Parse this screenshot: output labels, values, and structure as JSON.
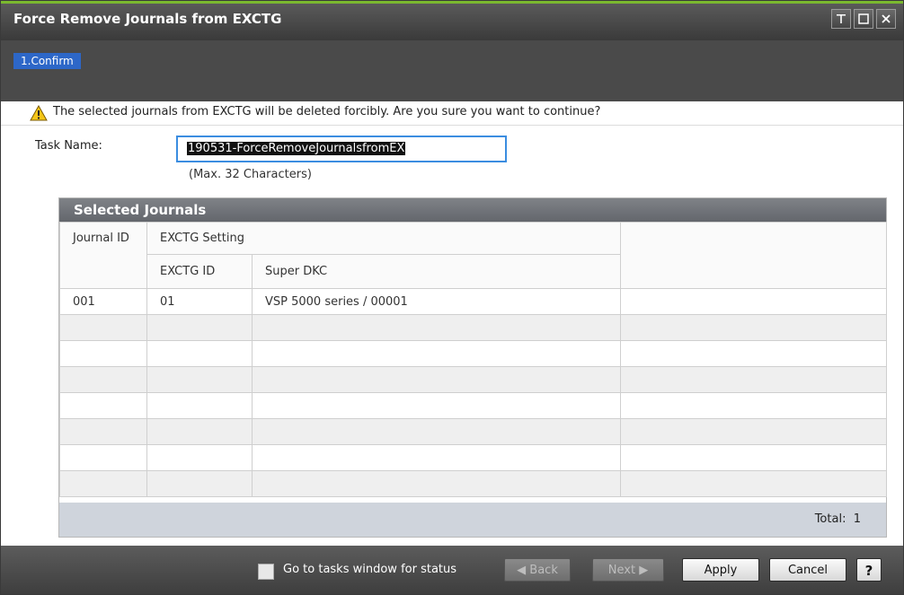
{
  "window": {
    "title": "Force Remove Journals from EXCTG",
    "controls": [
      "pin-icon",
      "maximize-icon",
      "close-icon"
    ]
  },
  "wizard": {
    "step": "1.Confirm"
  },
  "warning": {
    "icon": "warning-icon",
    "text": "The selected journals from EXCTG will be deleted forcibly. Are you sure you want to continue?"
  },
  "task": {
    "label": "Task Name:",
    "value": "190531-ForceRemoveJournalsfromEX",
    "hint": "(Max. 32 Characters)"
  },
  "journals": {
    "title": "Selected Journals",
    "headers": {
      "journal_id": "Journal ID",
      "exctg_setting": "EXCTG Setting",
      "exctg_id": "EXCTG ID",
      "super_dkc": "Super DKC"
    },
    "rows": [
      {
        "journal_id": "001",
        "exctg_id": "01",
        "super_dkc": "VSP 5000 series / 00001"
      }
    ],
    "total_label": "Total:",
    "total": "1"
  },
  "footer": {
    "goto_label": "Go to tasks window for status",
    "goto_checked": false,
    "back": "Back",
    "next": "Next",
    "apply": "Apply",
    "cancel": "Cancel",
    "help": "?"
  },
  "colors": {
    "accent_green": "#7bb92f",
    "step_blue": "#2d67c8",
    "focus_blue": "#3b8de0",
    "warning_yellow": "#f5c518"
  }
}
